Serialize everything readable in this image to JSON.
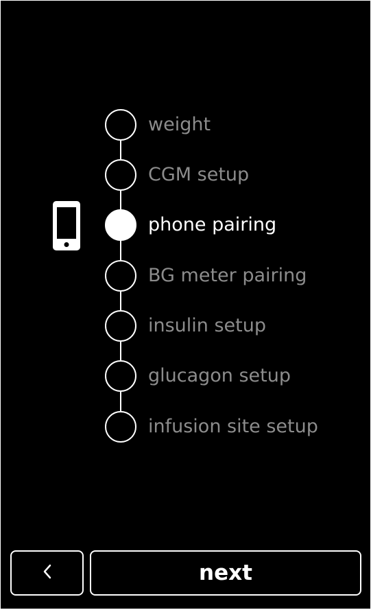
{
  "steps": [
    {
      "label": "weight",
      "state": "pending"
    },
    {
      "label": "CGM setup",
      "state": "pending"
    },
    {
      "label": "phone pairing",
      "state": "active"
    },
    {
      "label": "BG meter pairing",
      "state": "pending"
    },
    {
      "label": "insulin setup",
      "state": "pending"
    },
    {
      "label": "glucagon setup",
      "state": "pending"
    },
    {
      "label": "infusion site setup",
      "state": "pending"
    }
  ],
  "current_step_icon": "smartphone-icon",
  "footer": {
    "back_icon": "chevron-left-icon",
    "next_label": "next"
  },
  "colors": {
    "background": "#000000",
    "active": "#ffffff",
    "inactive_text": "#8c8c8c"
  }
}
